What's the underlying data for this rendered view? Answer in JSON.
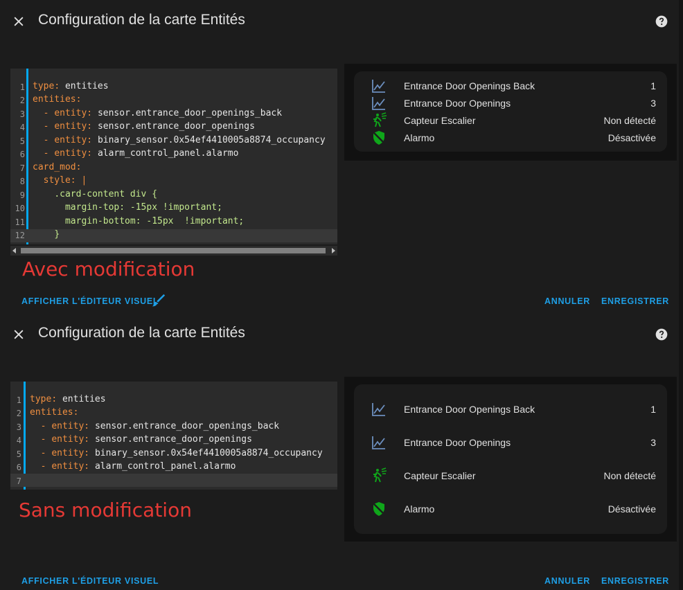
{
  "colors": {
    "accent": "#03a9f4",
    "annotation": "#e53935",
    "sensor_icon": "#6c8fbf",
    "green_icon": "#0fa61a"
  },
  "top": {
    "title": "Configuration de la carte Entités",
    "code_lines": [
      {
        "n": "1"
      },
      {
        "n": "2"
      },
      {
        "n": "3"
      },
      {
        "n": "4"
      },
      {
        "n": "5"
      },
      {
        "n": "6"
      },
      {
        "n": "7"
      },
      {
        "n": "8"
      },
      {
        "n": "9"
      },
      {
        "n": "10"
      },
      {
        "n": "11"
      },
      {
        "n": "12"
      }
    ],
    "code": {
      "l1k": "type",
      "l1v": "entities",
      "l2k": "entities",
      "l3k": "entity",
      "l3v": "sensor.entrance_door_openings_back",
      "l4k": "entity",
      "l4v": "sensor.entrance_door_openings",
      "l5k": "entity",
      "l5v": "binary_sensor.0x54ef4410005a8874_occupancy",
      "l6k": "entity",
      "l6v": "alarm_control_panel.alarmo",
      "l7k": "card_mod",
      "l8k": "style",
      "l8v": "|",
      "l9": ".card-content div {",
      "l10": "margin-top: -15px !important;",
      "l11": "margin-bottom: -15px  !important;",
      "l12": "}"
    },
    "annotation": "Avec modification",
    "entities": [
      {
        "icon": "chart-line-icon",
        "name": "Entrance Door Openings Back",
        "state": "1"
      },
      {
        "icon": "chart-line-icon",
        "name": "Entrance Door Openings",
        "state": "3"
      },
      {
        "icon": "motion-sensor-icon",
        "name": "Capteur Escalier",
        "state": "Non détecté"
      },
      {
        "icon": "shield-off-icon",
        "name": "Alarmo",
        "state": "Désactivée"
      }
    ],
    "show_visual_editor": "AFFICHER L'ÉDITEUR VISUEL",
    "cancel": "ANNULER",
    "save": "ENREGISTRER"
  },
  "bottom": {
    "title": "Configuration de la carte Entités",
    "code_lines": [
      {
        "n": "1"
      },
      {
        "n": "2"
      },
      {
        "n": "3"
      },
      {
        "n": "4"
      },
      {
        "n": "5"
      },
      {
        "n": "6"
      },
      {
        "n": "7"
      }
    ],
    "code": {
      "l1k": "type",
      "l1v": "entities",
      "l2k": "entities",
      "l3k": "entity",
      "l3v": "sensor.entrance_door_openings_back",
      "l4k": "entity",
      "l4v": "sensor.entrance_door_openings",
      "l5k": "entity",
      "l5v": "binary_sensor.0x54ef4410005a8874_occupancy",
      "l6k": "entity",
      "l6v": "alarm_control_panel.alarmo"
    },
    "annotation": "Sans modification",
    "entities": [
      {
        "icon": "chart-line-icon",
        "name": "Entrance Door Openings Back",
        "state": "1"
      },
      {
        "icon": "chart-line-icon",
        "name": "Entrance Door Openings",
        "state": "3"
      },
      {
        "icon": "motion-sensor-icon",
        "name": "Capteur Escalier",
        "state": "Non détecté"
      },
      {
        "icon": "shield-off-icon",
        "name": "Alarmo",
        "state": "Désactivée"
      }
    ],
    "show_visual_editor": "AFFICHER L'ÉDITEUR VISUEL",
    "cancel": "ANNULER",
    "save": "ENREGISTRER"
  }
}
